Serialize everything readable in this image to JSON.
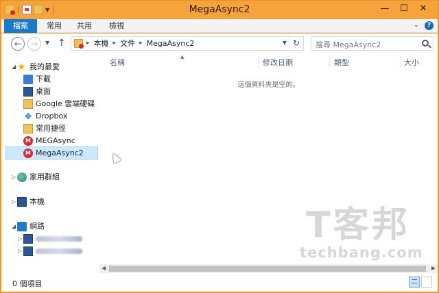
{
  "window": {
    "title": "MegaAsync2",
    "controls": {
      "minimize": "—",
      "maximize": "☐",
      "close": "✕"
    }
  },
  "ribbon": {
    "file_tab": "檔案",
    "tabs": [
      "常用",
      "共用",
      "檢視"
    ],
    "help": "?"
  },
  "address": {
    "crumbs": [
      "本機",
      "文件",
      "MegaAsync2"
    ],
    "refresh": "↻"
  },
  "search": {
    "placeholder": "搜尋 MegaAsync2"
  },
  "nav": {
    "favorites": {
      "label": "我的最愛",
      "items": [
        {
          "label": "下載",
          "icon": "download-folder-icon"
        },
        {
          "label": "桌面",
          "icon": "desktop-icon"
        },
        {
          "label": "Google 雲端硬碟",
          "icon": "google-drive-folder-icon"
        },
        {
          "label": "Dropbox",
          "icon": "dropbox-icon"
        },
        {
          "label": "常用捷徑",
          "icon": "recent-places-icon"
        },
        {
          "label": "MEGAsync",
          "icon": "mega-icon"
        },
        {
          "label": "MegaAsync2",
          "icon": "mega-icon"
        }
      ]
    },
    "homegroup": "家用群組",
    "this_pc": "本機",
    "network": "網路"
  },
  "columns": [
    "名稱",
    "修改日期",
    "類型",
    "大小"
  ],
  "empty_message": "這個資料夾是空的。",
  "status": {
    "count": "0 個項目"
  },
  "watermark": {
    "big": "T客邦",
    "small": "techbang.com"
  },
  "colors": {
    "frame": "#f7a33b",
    "file_tab": "#1979ca",
    "selection": "#cce8ff"
  }
}
